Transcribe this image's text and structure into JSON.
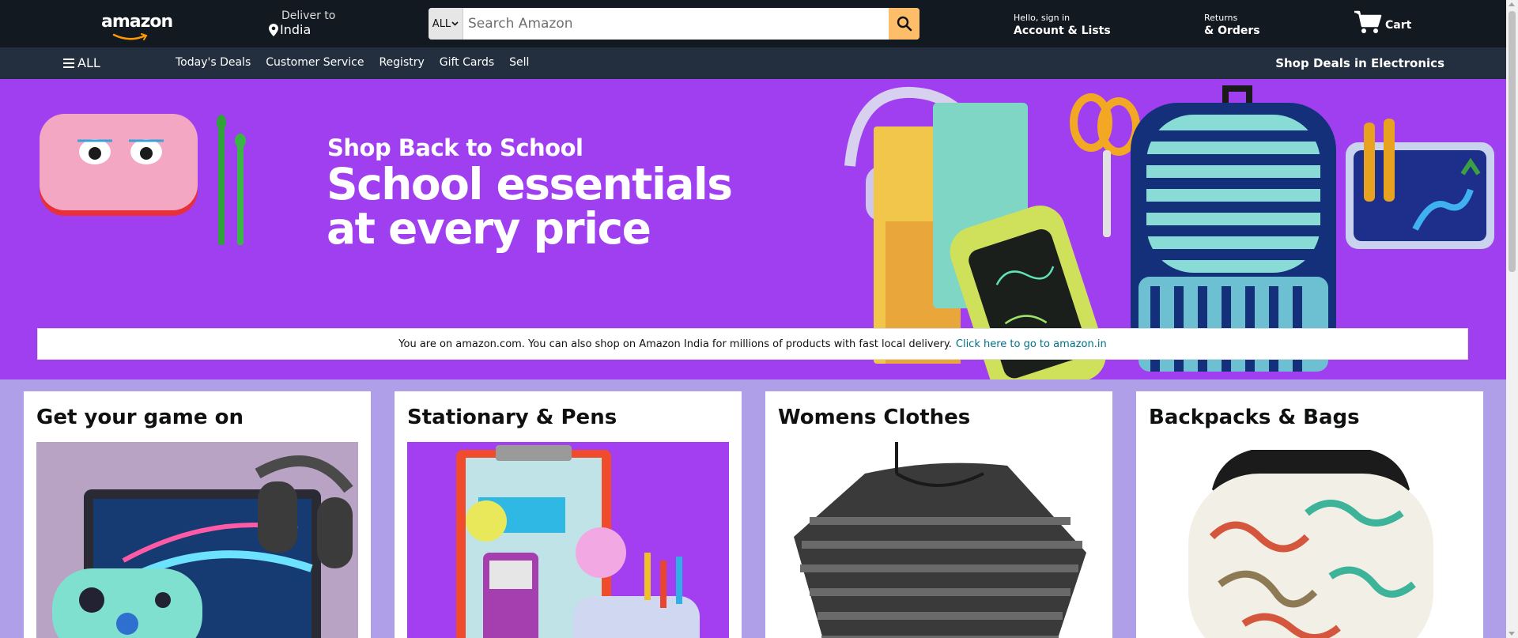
{
  "header": {
    "logo_text": "amazon",
    "deliver_label": "Deliver to",
    "deliver_location": "India",
    "search": {
      "category": "ALL",
      "placeholder": "Search Amazon"
    },
    "account": {
      "line1": "Hello, sign in",
      "line2": "Account & Lists"
    },
    "returns": {
      "line1": "Returns",
      "line2": "& Orders"
    },
    "cart_label": "Cart"
  },
  "subnav": {
    "all_label": "ALL",
    "links": [
      "Today's Deals",
      "Customer Service",
      "Registry",
      "Gift Cards",
      "Sell"
    ],
    "right_link": "Shop Deals in Electronics"
  },
  "hero": {
    "kicker": "Shop Back to School",
    "title_line1": "School essentials",
    "title_line2": "at every price"
  },
  "notice": {
    "text": "You are on amazon.com. You can also shop on Amazon India for millions of products with fast local delivery.",
    "link": "Click here to go to amazon.in"
  },
  "cards": [
    {
      "title": "Get your game on"
    },
    {
      "title": "Stationary & Pens"
    },
    {
      "title": "Womens Clothes"
    },
    {
      "title": "Backpacks & Bags"
    }
  ],
  "colors": {
    "nav_dark": "#131921",
    "subnav": "#232f3e",
    "search_button": "#febd69",
    "hero_purple": "#a03ff0",
    "page_bg": "#af9fe8",
    "link": "#007185"
  }
}
